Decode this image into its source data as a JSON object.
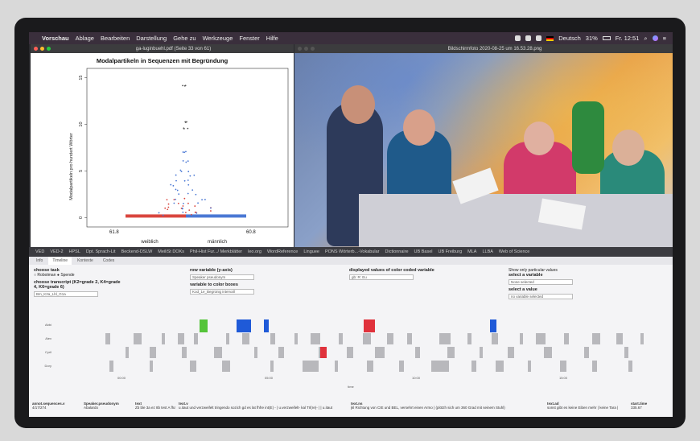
{
  "menubar": {
    "app": "Vorschau",
    "items": [
      "Ablage",
      "Bearbeiten",
      "Darstellung",
      "Gehe zu",
      "Werkzeuge",
      "Fenster",
      "Hilfe"
    ],
    "input_lang": "Deutsch",
    "battery": "31%",
    "clock": "Fr. 12:51"
  },
  "pdf_window": {
    "title": "ga-luginbuehl.pdf (Seite 33 von 61)"
  },
  "photo_window": {
    "title": "Bildschirmfoto 2020-08-25 um 16.53.28.png"
  },
  "chart_data": {
    "type": "scatter",
    "title": "Modalpartikeln in Sequenzen mit Begründung",
    "ylabel": "Modalpartikeln pro hundert Wörter",
    "categories": [
      "weiblich",
      "männlich"
    ],
    "y_ticks": [
      0,
      5,
      10,
      15
    ],
    "ylim": [
      -1,
      16
    ],
    "annotations": [
      "61.8",
      "60.8"
    ],
    "series": [
      {
        "color": "#d9463e",
        "values": [
          0.1,
          0.3,
          0.5,
          0.8,
          1.0,
          1.2,
          1.5,
          2.0
        ]
      },
      {
        "color": "#4a78d4",
        "values": [
          0.2,
          0.5,
          1.0,
          1.5,
          2.0,
          2.5,
          3.0,
          3.5,
          4.0,
          4.5,
          5.0,
          6.0,
          7.0
        ]
      },
      {
        "color": "#555555",
        "values": [
          9.5,
          10.2,
          14.2
        ]
      }
    ]
  },
  "bookmarks": [
    "VED",
    "VED-2",
    "HPSL",
    "Dpt. Sprach-Lit",
    "Beckend-DSLW",
    "MeiliSt DOKs",
    "Phil-Hist Fur.../ Merkblätter",
    "leo.org",
    "WordReference",
    "Linguee",
    "PONS Wörterb...-Vokabular",
    "Dictionnaire",
    "UB Basel",
    "UB Freiburg",
    "MLA",
    "LLBA",
    "Web of Science"
  ],
  "app": {
    "tabs": [
      "Info",
      "Timeline",
      "Kontexte",
      "Codes"
    ],
    "active_tab": "Timeline",
    "task_label": "choose task",
    "task_options": [
      "Robotman",
      "Spende"
    ],
    "transcript_label": "choose transcript (K2=grade 2, K4=grade 4, K6=grade 6)",
    "transcript_value": "Bm_K2a_Lbl_G1a",
    "row_var_label": "row variable (y-axis)",
    "row_var_value": "Speaker pseudonym",
    "color_var_label": "variable to color boxes",
    "color_var_value": "Kod_1e_Begrünig intervall",
    "displayed_label": "displayed values of color coded variable",
    "displayed_value": "gb: R: Eu",
    "show_label": "Show only particular values",
    "select_var_label": "select a variable",
    "select_var_placeholder": "None selected",
    "select_val_label": "select a value",
    "select_val_placeholder": "no variable selected",
    "rows": [
      "Abbi",
      "Alex",
      "Cyril",
      "Dory"
    ],
    "x_ticks": [
      "00:00",
      "05:00",
      "10:00",
      "15:00"
    ],
    "x_label": "time",
    "table_headers": [
      "annot.sequences.v",
      "Speaker.pseudonym",
      "text",
      "text.v",
      "text.ns",
      "text.ad",
      "start.time"
    ],
    "table_row": [
      "4/17/274",
      "Abalardo",
      "Zb ble 3a ez 8b test A fhage",
      "u.itaut und verzweifelt tringendo sozich gd es lat fhfre int(E) - | u.verzweifelt- kal Trl(re)- | | u.itaut",
      "jkl Richtung von CIE und BEL, versehrt einen Armo | (plötzh sich um 360 Grad mit seinem Stuhl)",
      "sonst gibt es keine Eiben mehr | keine Tara |",
      "335.67"
    ]
  }
}
